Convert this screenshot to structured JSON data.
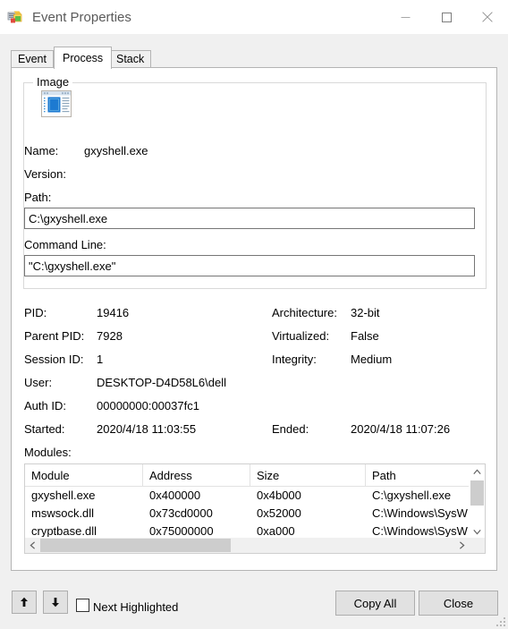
{
  "window": {
    "title": "Event Properties",
    "icon": "procmon-icon",
    "controls": {
      "minimize": "minimize-icon",
      "maximize": "maximize-icon",
      "close": "close-icon"
    }
  },
  "tabs": [
    {
      "label": "Event",
      "selected": false
    },
    {
      "label": "Process",
      "selected": true
    },
    {
      "label": "Stack",
      "selected": false
    }
  ],
  "image_group": {
    "legend": "Image",
    "icon": "application-window-icon",
    "name_label": "Name:",
    "name_value": "gxyshell.exe",
    "version_label": "Version:",
    "version_value": "",
    "path_label": "Path:",
    "path_value": "C:\\gxyshell.exe",
    "command_line_label": "Command Line:",
    "command_line_value": "\"C:\\gxyshell.exe\""
  },
  "details": {
    "left": [
      {
        "label": "PID:",
        "value": "19416"
      },
      {
        "label": "Parent PID:",
        "value": "7928"
      },
      {
        "label": "Session ID:",
        "value": "1"
      },
      {
        "label": "User:",
        "value": "DESKTOP-D4D58L6\\dell"
      },
      {
        "label": "Auth ID:",
        "value": "00000000:00037fc1"
      },
      {
        "label": "Started:",
        "value": "2020/4/18 11:03:55"
      }
    ],
    "right": [
      {
        "label": "Architecture:",
        "value": "32-bit"
      },
      {
        "label": "Virtualized:",
        "value": "False"
      },
      {
        "label": "Integrity:",
        "value": "Medium"
      },
      {
        "label": "Ended:",
        "value": "2020/4/18 11:07:26"
      }
    ]
  },
  "modules": {
    "label": "Modules:",
    "columns": [
      "Module",
      "Address",
      "Size",
      "Path"
    ],
    "rows": [
      {
        "module": "gxyshell.exe",
        "address": "0x400000",
        "size": "0x4b000",
        "path": "C:\\gxyshell.exe"
      },
      {
        "module": "mswsock.dll",
        "address": "0x73cd0000",
        "size": "0x52000",
        "path": "C:\\Windows\\SysW"
      },
      {
        "module": "cryptbase.dll",
        "address": "0x75000000",
        "size": "0xa000",
        "path": "C:\\Windows\\SysW"
      }
    ],
    "scroll_up": "chevron-up-icon",
    "scroll_down": "chevron-down-icon",
    "scroll_left": "chevron-left-icon",
    "scroll_right": "chevron-right-icon"
  },
  "footer": {
    "prev_label": "up-arrow-icon",
    "next_label": "down-arrow-icon",
    "checkbox_label": "Next Highlighted",
    "copy_all_label": "Copy All",
    "close_label": "Close"
  },
  "colors": {
    "titlebar_bg": "#ffffff",
    "dialog_bg": "#f0f0f0",
    "panel_bg": "#ffffff",
    "button_face": "#e1e1e1",
    "border": "#b4b4b4",
    "text": "#000000",
    "title_text": "#5a5a5a",
    "icon_blue": "#1f7fd1",
    "scroll_thumb": "#cdcdcd"
  }
}
